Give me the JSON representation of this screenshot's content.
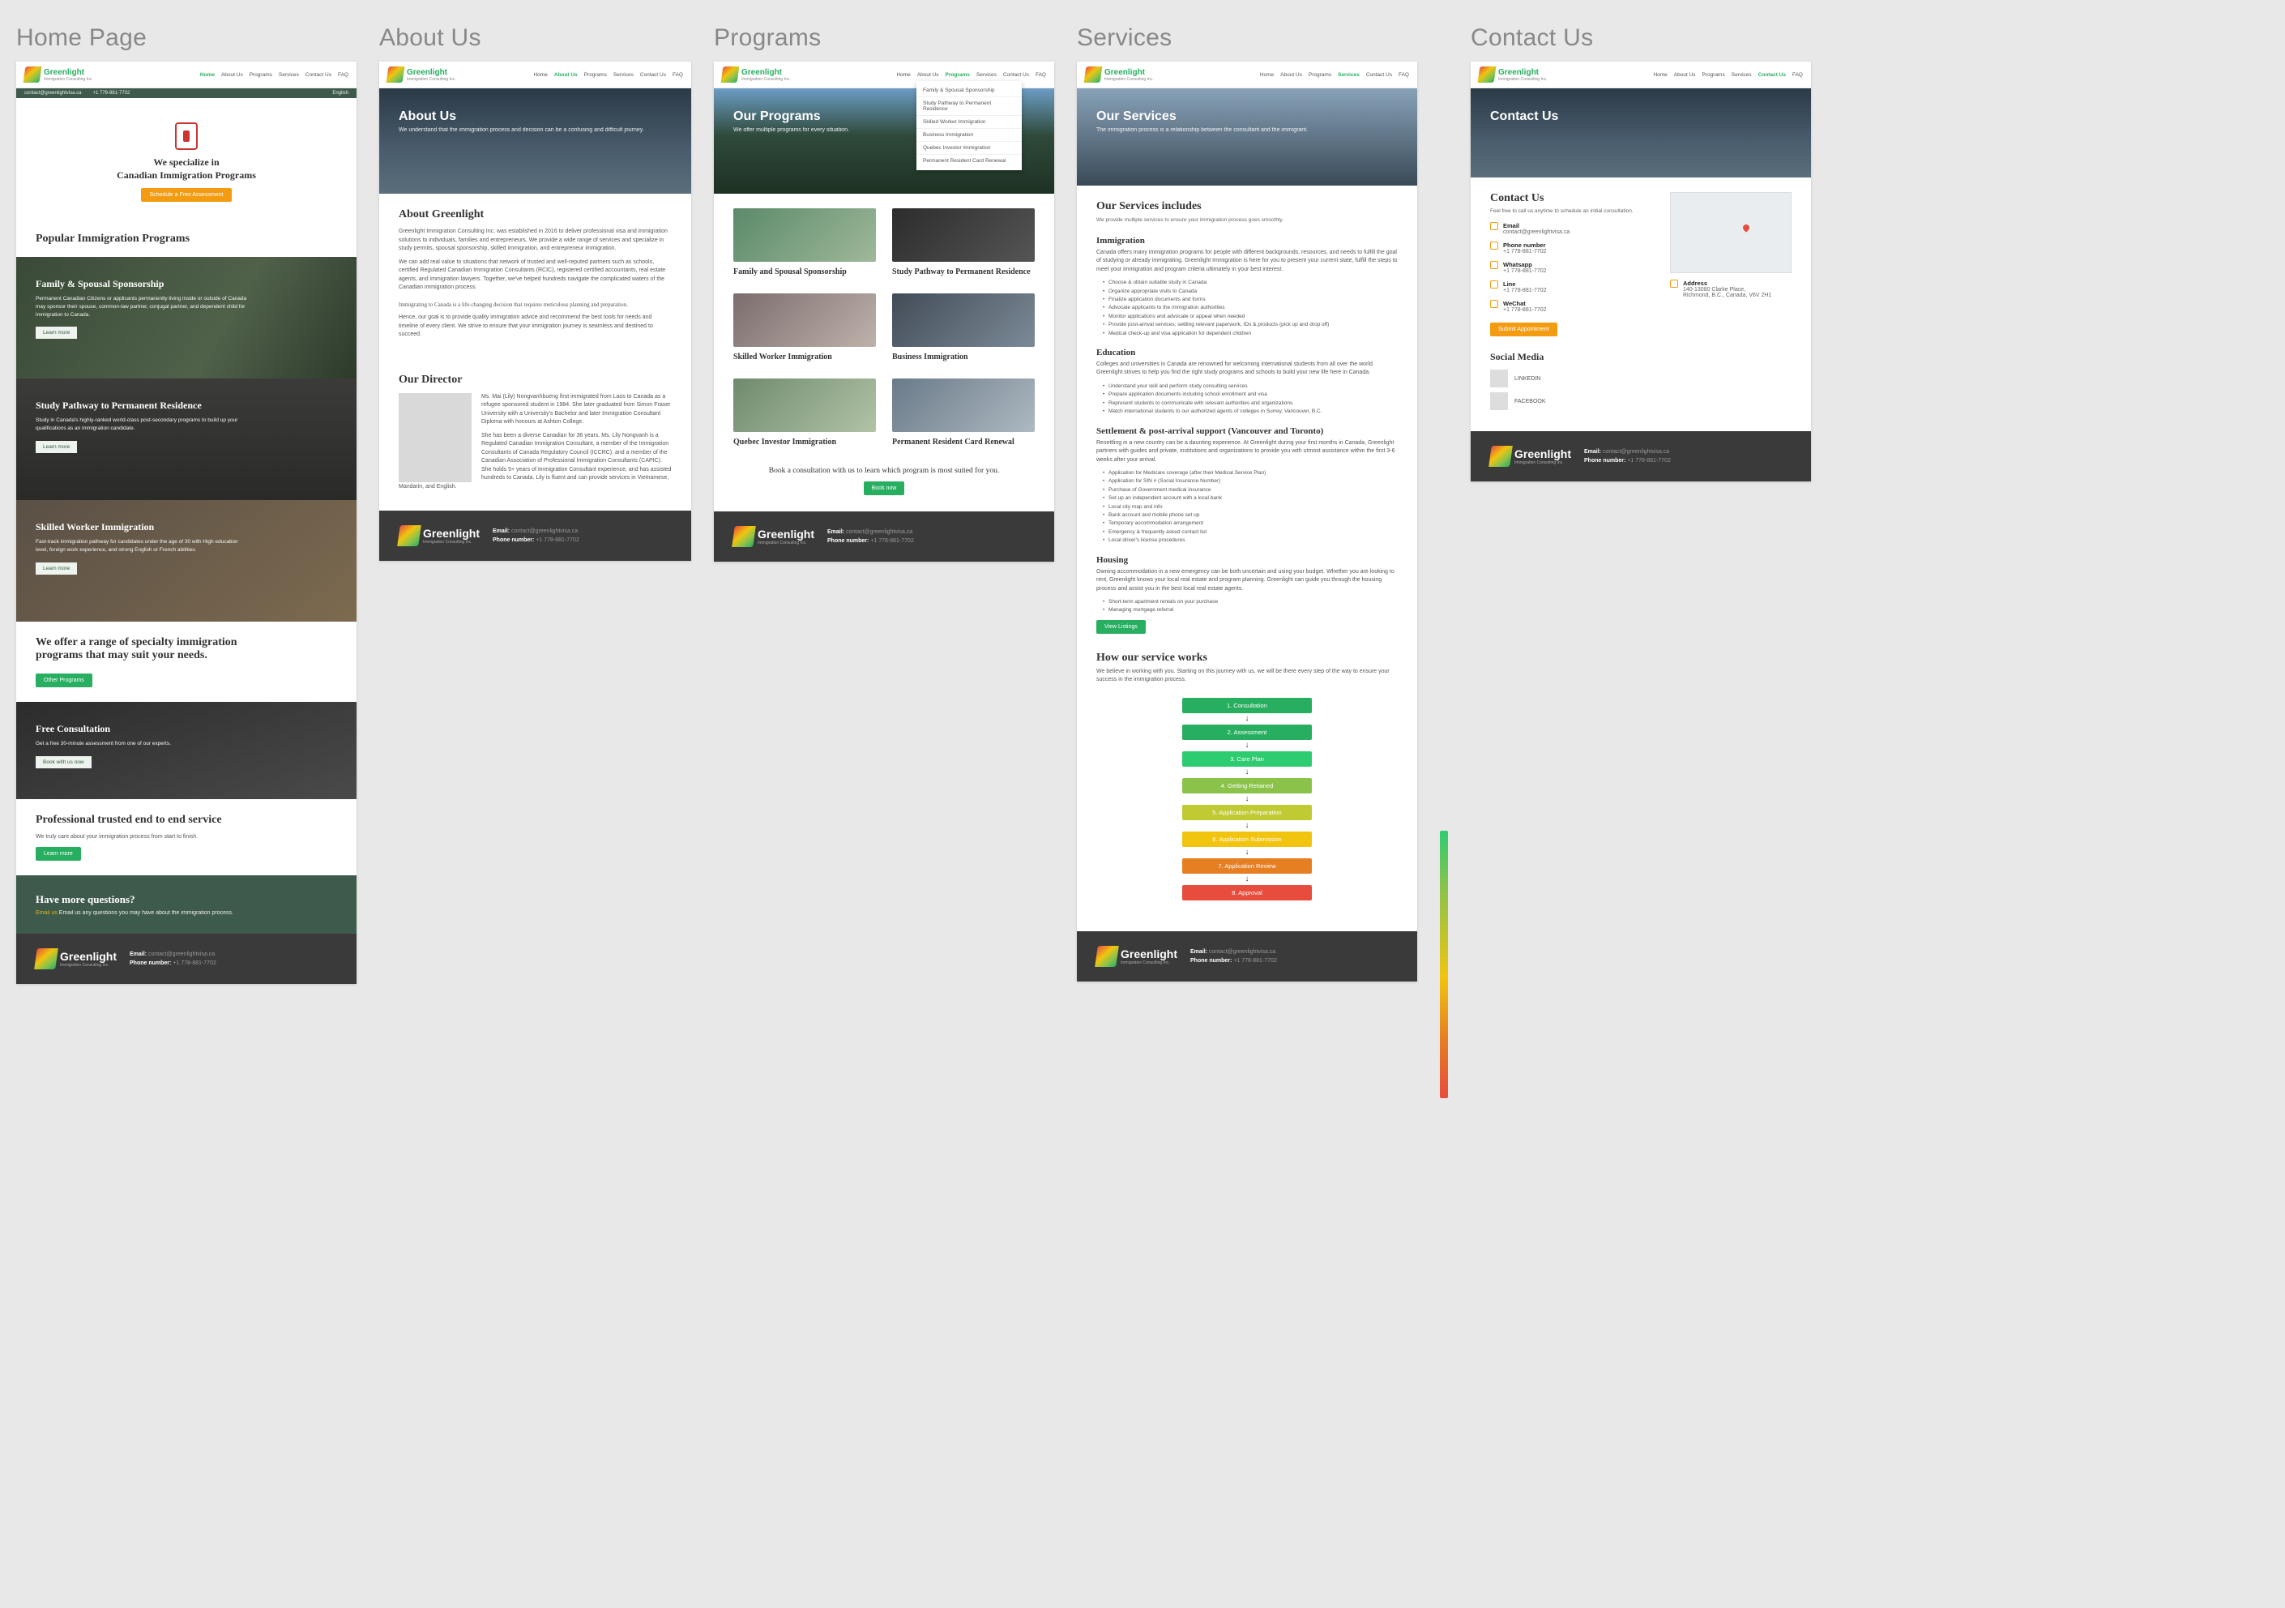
{
  "columns": {
    "home": "Home Page",
    "about": "About Us",
    "programs": "Programs",
    "services": "Services",
    "contact": "Contact Us"
  },
  "brand": {
    "name": "Greenlight",
    "tag": "Immigration Consulting Inc."
  },
  "nav": {
    "home": "Home",
    "about": "About Us",
    "programs": "Programs",
    "services": "Services",
    "contact": "Contact Us",
    "faq": "FAQ"
  },
  "topbar": {
    "email": "contact@greenlightvisa.ca",
    "phone": "+1 778-881-7702",
    "lang": "English"
  },
  "footer": {
    "email_label": "Email:",
    "email": "contact@greenlightvisa.ca",
    "phone_label": "Phone number:",
    "phone": "+1 778-881-7702"
  },
  "home": {
    "intro_title": "We specialize in\nCanadian Immigration Programs",
    "intro_btn": "Schedule a Free Assessment",
    "popular": "Popular Immigration Programs",
    "band1": {
      "title": "Family & Spousal Sponsorship",
      "body": "Permanent Canadian Citizens or applicants permanently living inside or outside of Canada may sponsor their spouse, common-law partner, conjugal partner, and dependent child for immigration to Canada.",
      "btn": "Learn more"
    },
    "band2": {
      "title": "Study Pathway to Permanent Residence",
      "body": "Study in Canada's highly-ranked world-class post-secondary programs to build up your qualifications as an immigration candidate.",
      "btn": "Learn more"
    },
    "band3": {
      "title": "Skilled Worker Immigration",
      "body": "Fast-track immigration pathway for candidates under the age of 30 with High education level, foreign work experience, and strong English or French abilities.",
      "btn": "Learn more"
    },
    "specialty": {
      "title": "We offer a range of specialty immigration programs that may suit your needs.",
      "btn": "Other Programs"
    },
    "free": {
      "title": "Free Consultation",
      "body": "Get a free 30-minute assessment from one of our experts.",
      "btn": "Book with us now"
    },
    "trusted": {
      "title": "Professional trusted end to end service",
      "body": "We truly care about your immigration process from start to finish.",
      "btn": "Learn more"
    },
    "more": {
      "title": "Have more questions?",
      "body": "Email us any questions you may have about the immigration process.",
      "link": "Email us"
    }
  },
  "about": {
    "hero_title": "About Us",
    "hero_sub": "We understand that the immigration process and decision can be a confusing and difficult journey.",
    "h": "About Greenlight",
    "p1": "Greenlight Immigration Consulting Inc. was established in 2016 to deliver professional visa and immigration solutions to individuals, families and entrepreneurs. We provide a wide range of services and specialize in study permits, spousal sponsorship, skilled immigration, and entrepreneur immigration.",
    "p2": "We can add real value to situations that network of trusted and well-reputed partners such as schools, certified Regulated Canadian Immigration Consultants (RCIC), registered certified accountants, real estate agents, and immigration lawyers. Together, we've helped hundreds navigate the complicated waters of the Canadian immigration process.",
    "lead": "Immigrating to Canada is a life-changing decision that requires meticulous planning and preparation.",
    "p3": "Hence, our goal is to provide quality immigration advice and recommend the best tools for needs and timeline of every client. We strive to ensure that your immigration journey is seamless and destined to succeed.",
    "dir": "Our Director",
    "dir_p1": "Ms. Mai (Lily) Nongvanhbueng first immigrated from Laos to Canada as a refugee sponsored student in 1984. She later graduated from Simon Fraser University with a University's Bachelor and later Immigration Consultant Diploma with honours at Ashton College.",
    "dir_p2": "She has been a diverse Canadian for 36 years. Ms. Lily Nongvanh is a Regulated Canadian Immigration Consultant, a member of the Immigration Consultants of Canada Regulatory Council (ICCRC), and a member of the Canadian Association of Professional Immigration Consultants (CAPIC). She holds 5+ years of Immigration Consultant experience, and has assisted hundreds to Canada. Lily is fluent and can provide services in Vietnamese, Mandarin, and English."
  },
  "programs": {
    "hero_title": "Our Programs",
    "hero_sub": "We offer multiple programs for every situation.",
    "dd": [
      "Family & Spousal Sponsorship",
      "Study Pathway to Permanent Residence",
      "Skilled Worker Immigration",
      "Business Immigration",
      "Quebec Investor Immigration",
      "Permanent Resident Card Renewal"
    ],
    "cards": [
      "Family and Spousal Sponsorship",
      "Study Pathway to Permanent Residence",
      "Skilled Worker Immigration",
      "Business Immigration",
      "Quebec Investor Immigration",
      "Permanent Resident Card Renewal"
    ],
    "book": "Book a consultation with us to learn which program is most suited for you.",
    "book_btn": "Book now"
  },
  "services": {
    "hero_title": "Our Services",
    "hero_sub": "The immigration process is a relationship between the consultant and the immigrant.",
    "h": "Our Services includes",
    "sub": "We provide multiple services to ensure your immigration process goes smoothly.",
    "imm": "Immigration",
    "imm_p": "Canada offers many immigration programs for people with different backgrounds, resources, and needs to fulfill the goal of studying or already immigrating. Greenlight Immigration is here for you to present your current state, fulfill the steps to meet your immigration and program criteria ultimately in your best interest.",
    "imm_list": [
      "Choose & obtain suitable study in Canada",
      "Organize appropriate visits to Canada",
      "Finalize application documents and forms",
      "Advocate applicants to the immigration authorities",
      "Monitor applications and advocate or appeal when needed",
      "Provide post-arrival services; settling relevant paperwork, IDs & products (pick up and drop off)",
      "Medical check-up and visa application for dependent children"
    ],
    "edu": "Education",
    "edu_p": "Colleges and universities in Canada are renowned for welcoming international students from all over the world. Greenlight strives to help you find the right study programs and schools to build your new life here in Canada.",
    "edu_list": [
      "Understand your skill and perform study consulting services",
      "Prepare application documents including school enrollment and visa",
      "Represent students to communicate with relevant authorities and organizations",
      "Match international students to our authorized agents of colleges in Surrey, Vancouver, B.C."
    ],
    "set": "Settlement & post-arrival support (Vancouver and Toronto)",
    "set_p": "Resettling in a new country can be a daunting experience. At Greenlight during your first months in Canada, Greenlight partners with guides and private, institutions and organizations to provide you with utmost assistance within the first 3-6 weeks after your arrival.",
    "set_list": [
      "Application for Medicare coverage (after their Medical Service Plan)",
      "Application for SIN # (Social Insurance Number)",
      "Purchase of Government medical insurance",
      "Set up an independent account with a local bank",
      "Local city map and info",
      "Bank account and mobile phone set up",
      "Temporary accommodation arrangement",
      "Emergency & frequently asked contact list",
      "Local driver's license procedures"
    ],
    "hou": "Housing",
    "hou_p": "Owning accommodation in a new emergency can be both uncertain and using your budget. Whether you are looking to rent, Greenlight knows your local real estate and program planning. Greenlight can guide you through the housing process and assist you in the best local real estate agents.",
    "hou_list": [
      "Short-term apartment rentals on your purchase",
      "Managing mortgage referral"
    ],
    "hou_btn": "View Listings",
    "how": "How our service works",
    "how_p": "We believe in working with you. Starting on this journey with us, we will be there every step of the way to ensure your success in the immigration process.",
    "steps": [
      "1. Consultation",
      "2. Assessment",
      "3. Care Plan",
      "4. Getting Retained",
      "5. Application Preparation",
      "6. Application Submission",
      "7. Application Review",
      "8. Approval"
    ]
  },
  "contact": {
    "hero": "Contact Us",
    "h": "Contact Us",
    "lead": "Feel free to call us anytime to schedule an initial consultation.",
    "email_l": "Email",
    "email": "contact@greenlightvisa.ca",
    "phone_l": "Phone number",
    "phone": "+1 778-881-7702",
    "wa_l": "Whatsapp",
    "wa": "+1 778-881-7702",
    "line_l": "Line",
    "line": "+1 778-881-7702",
    "wc_l": "WeChat",
    "wc": "+1 778-881-7702",
    "btn": "Submit Appointment",
    "addr_l": "Address",
    "addr": "140-13080 Clarke Place,\nRichmond, B.C., Canada, V6V 2H1",
    "social": "Social Media",
    "li": "LINKEDIN",
    "fb": "FACEBOOK"
  }
}
